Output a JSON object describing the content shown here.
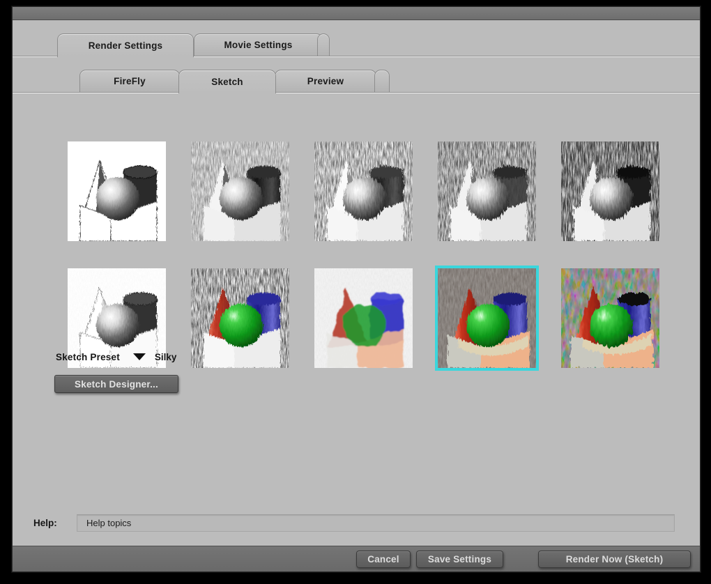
{
  "window": {
    "title": ""
  },
  "tabs_primary": [
    {
      "id": "render-settings",
      "label": "Render Settings",
      "active": true
    },
    {
      "id": "movie-settings",
      "label": "Movie Settings",
      "active": false
    }
  ],
  "tabs_secondary": [
    {
      "id": "firefly",
      "label": "FireFly",
      "active": false
    },
    {
      "id": "sketch",
      "label": "Sketch",
      "active": true
    },
    {
      "id": "preview",
      "label": "Preview",
      "active": false
    }
  ],
  "thumbnails": {
    "selected_index": 8,
    "items": [
      {
        "index": 0,
        "name": "pencil-outline-light",
        "style": "pencil-light",
        "selected": false
      },
      {
        "index": 1,
        "name": "charcoal-dark",
        "style": "charcoal",
        "selected": false
      },
      {
        "index": 2,
        "name": "soft-graphite",
        "style": "graphite-soft",
        "selected": false
      },
      {
        "index": 3,
        "name": "hatch-dark",
        "style": "hatch-dark",
        "selected": false
      },
      {
        "index": 4,
        "name": "heavy-charcoal",
        "style": "charcoal-heavy",
        "selected": false
      },
      {
        "index": 5,
        "name": "silverpoint-light",
        "style": "silverpoint",
        "selected": false
      },
      {
        "index": 6,
        "name": "color-pencil",
        "style": "color-pencil",
        "selected": false
      },
      {
        "index": 7,
        "name": "watercolor",
        "style": "watercolor",
        "selected": false
      },
      {
        "index": 8,
        "name": "silky",
        "style": "silky",
        "selected": true
      },
      {
        "index": 9,
        "name": "color-impressionist",
        "style": "impressionist",
        "selected": false
      }
    ]
  },
  "preset": {
    "label": "Sketch Preset",
    "value": "Silky",
    "arrow_icon": "chevron-down-icon"
  },
  "sketch_designer": {
    "label": "Sketch Designer..."
  },
  "help": {
    "label": "Help:",
    "value": "Help topics"
  },
  "footer": {
    "cancel_label": "Cancel",
    "save_label": "Save Settings",
    "render_label": "Render Now (Sketch)"
  },
  "colors": {
    "selection": "#3ad6dc",
    "window_bg": "#bcbcbc",
    "chrome_dark": "#6f6f6f",
    "button_face": "#5e5e5e",
    "text": "#161616"
  }
}
